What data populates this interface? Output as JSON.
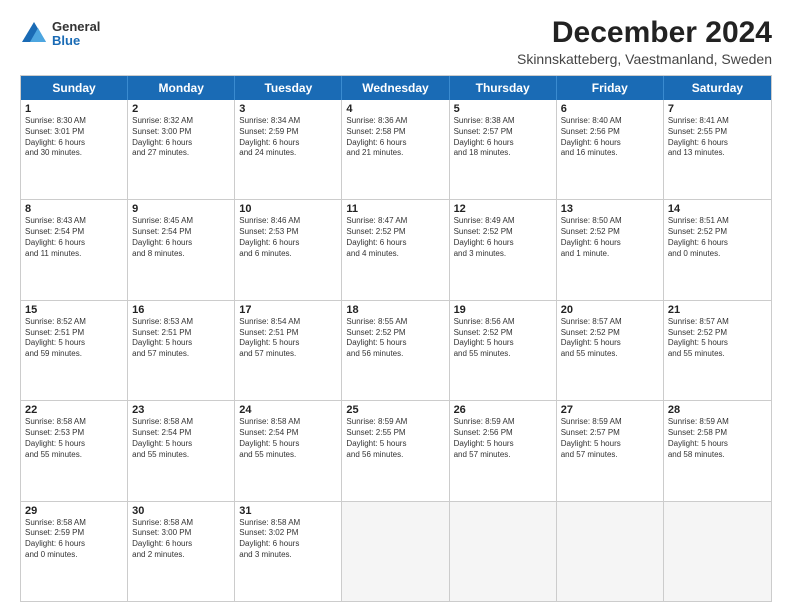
{
  "logo": {
    "general": "General",
    "blue": "Blue"
  },
  "title": "December 2024",
  "subtitle": "Skinnskatteberg, Vaestmanland, Sweden",
  "header_days": [
    "Sunday",
    "Monday",
    "Tuesday",
    "Wednesday",
    "Thursday",
    "Friday",
    "Saturday"
  ],
  "weeks": [
    [
      {
        "day": "1",
        "lines": [
          "Sunrise: 8:30 AM",
          "Sunset: 3:01 PM",
          "Daylight: 6 hours",
          "and 30 minutes."
        ]
      },
      {
        "day": "2",
        "lines": [
          "Sunrise: 8:32 AM",
          "Sunset: 3:00 PM",
          "Daylight: 6 hours",
          "and 27 minutes."
        ]
      },
      {
        "day": "3",
        "lines": [
          "Sunrise: 8:34 AM",
          "Sunset: 2:59 PM",
          "Daylight: 6 hours",
          "and 24 minutes."
        ]
      },
      {
        "day": "4",
        "lines": [
          "Sunrise: 8:36 AM",
          "Sunset: 2:58 PM",
          "Daylight: 6 hours",
          "and 21 minutes."
        ]
      },
      {
        "day": "5",
        "lines": [
          "Sunrise: 8:38 AM",
          "Sunset: 2:57 PM",
          "Daylight: 6 hours",
          "and 18 minutes."
        ]
      },
      {
        "day": "6",
        "lines": [
          "Sunrise: 8:40 AM",
          "Sunset: 2:56 PM",
          "Daylight: 6 hours",
          "and 16 minutes."
        ]
      },
      {
        "day": "7",
        "lines": [
          "Sunrise: 8:41 AM",
          "Sunset: 2:55 PM",
          "Daylight: 6 hours",
          "and 13 minutes."
        ]
      }
    ],
    [
      {
        "day": "8",
        "lines": [
          "Sunrise: 8:43 AM",
          "Sunset: 2:54 PM",
          "Daylight: 6 hours",
          "and 11 minutes."
        ]
      },
      {
        "day": "9",
        "lines": [
          "Sunrise: 8:45 AM",
          "Sunset: 2:54 PM",
          "Daylight: 6 hours",
          "and 8 minutes."
        ]
      },
      {
        "day": "10",
        "lines": [
          "Sunrise: 8:46 AM",
          "Sunset: 2:53 PM",
          "Daylight: 6 hours",
          "and 6 minutes."
        ]
      },
      {
        "day": "11",
        "lines": [
          "Sunrise: 8:47 AM",
          "Sunset: 2:52 PM",
          "Daylight: 6 hours",
          "and 4 minutes."
        ]
      },
      {
        "day": "12",
        "lines": [
          "Sunrise: 8:49 AM",
          "Sunset: 2:52 PM",
          "Daylight: 6 hours",
          "and 3 minutes."
        ]
      },
      {
        "day": "13",
        "lines": [
          "Sunrise: 8:50 AM",
          "Sunset: 2:52 PM",
          "Daylight: 6 hours",
          "and 1 minute."
        ]
      },
      {
        "day": "14",
        "lines": [
          "Sunrise: 8:51 AM",
          "Sunset: 2:52 PM",
          "Daylight: 6 hours",
          "and 0 minutes."
        ]
      }
    ],
    [
      {
        "day": "15",
        "lines": [
          "Sunrise: 8:52 AM",
          "Sunset: 2:51 PM",
          "Daylight: 5 hours",
          "and 59 minutes."
        ]
      },
      {
        "day": "16",
        "lines": [
          "Sunrise: 8:53 AM",
          "Sunset: 2:51 PM",
          "Daylight: 5 hours",
          "and 57 minutes."
        ]
      },
      {
        "day": "17",
        "lines": [
          "Sunrise: 8:54 AM",
          "Sunset: 2:51 PM",
          "Daylight: 5 hours",
          "and 57 minutes."
        ]
      },
      {
        "day": "18",
        "lines": [
          "Sunrise: 8:55 AM",
          "Sunset: 2:52 PM",
          "Daylight: 5 hours",
          "and 56 minutes."
        ]
      },
      {
        "day": "19",
        "lines": [
          "Sunrise: 8:56 AM",
          "Sunset: 2:52 PM",
          "Daylight: 5 hours",
          "and 55 minutes."
        ]
      },
      {
        "day": "20",
        "lines": [
          "Sunrise: 8:57 AM",
          "Sunset: 2:52 PM",
          "Daylight: 5 hours",
          "and 55 minutes."
        ]
      },
      {
        "day": "21",
        "lines": [
          "Sunrise: 8:57 AM",
          "Sunset: 2:52 PM",
          "Daylight: 5 hours",
          "and 55 minutes."
        ]
      }
    ],
    [
      {
        "day": "22",
        "lines": [
          "Sunrise: 8:58 AM",
          "Sunset: 2:53 PM",
          "Daylight: 5 hours",
          "and 55 minutes."
        ]
      },
      {
        "day": "23",
        "lines": [
          "Sunrise: 8:58 AM",
          "Sunset: 2:54 PM",
          "Daylight: 5 hours",
          "and 55 minutes."
        ]
      },
      {
        "day": "24",
        "lines": [
          "Sunrise: 8:58 AM",
          "Sunset: 2:54 PM",
          "Daylight: 5 hours",
          "and 55 minutes."
        ]
      },
      {
        "day": "25",
        "lines": [
          "Sunrise: 8:59 AM",
          "Sunset: 2:55 PM",
          "Daylight: 5 hours",
          "and 56 minutes."
        ]
      },
      {
        "day": "26",
        "lines": [
          "Sunrise: 8:59 AM",
          "Sunset: 2:56 PM",
          "Daylight: 5 hours",
          "and 57 minutes."
        ]
      },
      {
        "day": "27",
        "lines": [
          "Sunrise: 8:59 AM",
          "Sunset: 2:57 PM",
          "Daylight: 5 hours",
          "and 57 minutes."
        ]
      },
      {
        "day": "28",
        "lines": [
          "Sunrise: 8:59 AM",
          "Sunset: 2:58 PM",
          "Daylight: 5 hours",
          "and 58 minutes."
        ]
      }
    ],
    [
      {
        "day": "29",
        "lines": [
          "Sunrise: 8:58 AM",
          "Sunset: 2:59 PM",
          "Daylight: 6 hours",
          "and 0 minutes."
        ]
      },
      {
        "day": "30",
        "lines": [
          "Sunrise: 8:58 AM",
          "Sunset: 3:00 PM",
          "Daylight: 6 hours",
          "and 2 minutes."
        ]
      },
      {
        "day": "31",
        "lines": [
          "Sunrise: 8:58 AM",
          "Sunset: 3:02 PM",
          "Daylight: 6 hours",
          "and 3 minutes."
        ]
      },
      {
        "day": "",
        "lines": []
      },
      {
        "day": "",
        "lines": []
      },
      {
        "day": "",
        "lines": []
      },
      {
        "day": "",
        "lines": []
      }
    ]
  ]
}
